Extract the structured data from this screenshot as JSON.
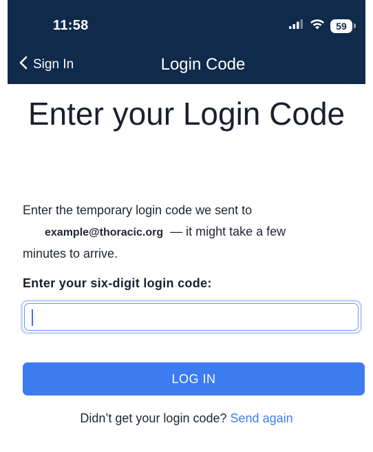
{
  "status_bar": {
    "time": "11:58",
    "battery_level": "59",
    "icons": [
      "signal-icon",
      "wifi-icon",
      "battery-icon"
    ]
  },
  "nav": {
    "back_label": "Sign In",
    "title": "Login Code"
  },
  "main": {
    "heading": "Enter your Login Code",
    "description_line1": "Enter the temporary login code we sent to",
    "email": "example@thoracic.org",
    "description_line2_rest": "— it might take a few",
    "description_line3": "minutes to arrive.",
    "field_label": "Enter your six-digit login code:",
    "code_value": "",
    "login_button": "LOG IN",
    "resend_prompt": "Didn’t get your login code?",
    "resend_link": "Send again"
  },
  "colors": {
    "header_bg": "#0f2a4a",
    "accent": "#3d7cf0",
    "text": "#1a1f2e"
  }
}
